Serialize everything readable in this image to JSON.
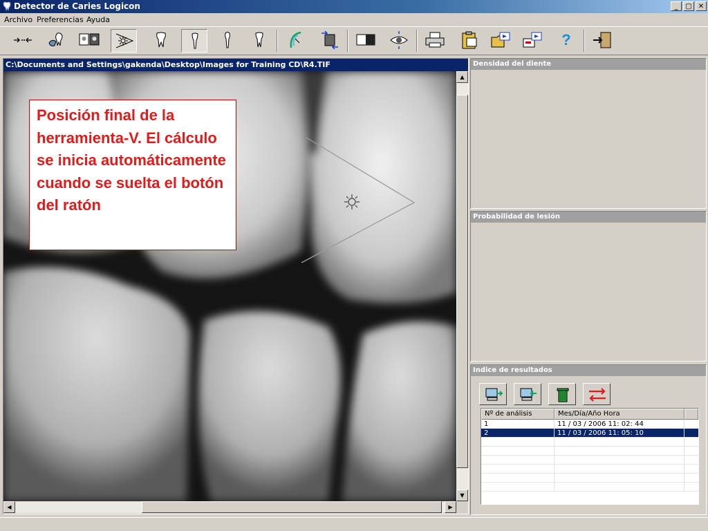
{
  "window": {
    "title": "Detector de Caries Logicon",
    "minimize_label": "_",
    "maximize_label": "▢",
    "close_label": "✕"
  },
  "menu": {
    "items": [
      "Archivo",
      "Preferencias",
      "Ayuda"
    ]
  },
  "toolbar": {
    "icons": [
      "arrows-icon",
      "tooth-tool-icon",
      "image-compare-icon",
      "v-tool-icon",
      "molar-icon",
      "incisor-icon",
      "canine-icon",
      "premolar-icon",
      "arc-icon",
      "flip-icon",
      "contrast-icon",
      "eye-icon",
      "print-icon",
      "clipboard-icon",
      "folder-open-icon",
      "export-icon",
      "help-icon",
      "exit-icon"
    ],
    "help_label": "?"
  },
  "image_panel": {
    "path": "C:\\Documents and Settings\\gakenda\\Desktop\\Images for Training CD\\R4.TIF"
  },
  "callout": {
    "text": "Posición final de la herramienta-V. El cálculo se inicia automáticamente cuando se suelta el botón del ratón"
  },
  "panels": {
    "density": "Densidad del diente",
    "probability": "Probabilidad de lesión",
    "results": "Indice de resultados"
  },
  "results_table": {
    "columns": [
      "Nº de análisis",
      "Mes/Día/Año  Hora"
    ],
    "rows": [
      {
        "num": "1",
        "datetime": "11 / 03 / 2006   11: 02: 44",
        "selected": false
      },
      {
        "num": "2",
        "datetime": "11 / 03 / 2006   11: 05: 10",
        "selected": true
      }
    ]
  },
  "colors": {
    "title_bar": "#0a246a",
    "callout_text": "#e01b1b",
    "panel_header": "#a0a0a0"
  }
}
